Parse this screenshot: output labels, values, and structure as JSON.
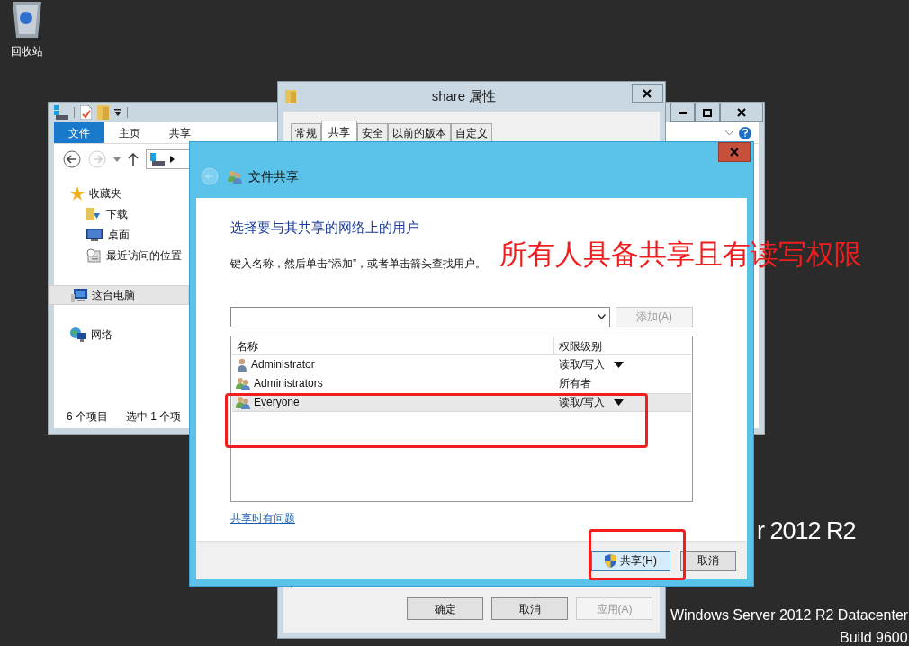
{
  "desktop": {
    "icons": [
      {
        "label": "回收站"
      }
    ],
    "branding": {
      "product": "r 2012 R2",
      "edition": "Windows Server 2012 R2 Datacenter",
      "build": "Build 9600"
    }
  },
  "explorer": {
    "ribbon_tabs": [
      {
        "label": "文件",
        "selected": true
      },
      {
        "label": "主页",
        "selected": false
      },
      {
        "label": "共享",
        "selected": false
      }
    ],
    "nav_pane": [
      {
        "label": "收藏夹",
        "selected": false,
        "children": [
          {
            "label": "下载",
            "selected": false
          },
          {
            "label": "桌面",
            "selected": false
          },
          {
            "label": "最近访问的位置",
            "selected": false
          }
        ]
      },
      {
        "label": "这台电脑",
        "selected": true
      },
      {
        "label": "网络",
        "selected": false
      }
    ],
    "status_bar": [
      "6 个项目",
      "选中 1 个项"
    ]
  },
  "properties": {
    "title": "share 属性",
    "tabs": [
      {
        "label": "常规",
        "selected": false
      },
      {
        "label": "共享",
        "selected": true
      },
      {
        "label": "安全",
        "selected": false
      },
      {
        "label": "以前的版本",
        "selected": false
      },
      {
        "label": "自定义",
        "selected": false
      }
    ],
    "buttons": [
      {
        "label": "确定",
        "disabled": false
      },
      {
        "label": "取消",
        "disabled": false
      },
      {
        "label": "应用(A)",
        "disabled": true
      }
    ]
  },
  "dialog": {
    "title": "文件共享",
    "heading": "选择要与其共享的网络上的用户",
    "instruction": "键入名称，然后单击“添加”，或者单击箭头查找用户。",
    "add_button": {
      "label": "添加(A)",
      "disabled": true
    },
    "table": {
      "columns": [
        "名称",
        "权限级别"
      ],
      "rows": [
        {
          "name": "Administrator",
          "kind": "user",
          "permission": "读取/写入",
          "has_menu": true,
          "selected": false
        },
        {
          "name": "Administrators",
          "kind": "group",
          "permission": "所有者",
          "has_menu": false,
          "selected": false
        },
        {
          "name": "Everyone",
          "kind": "group",
          "permission": "读取/写入",
          "has_menu": true,
          "selected": true
        }
      ]
    },
    "help_link": "共享时有问题",
    "buttons": [
      {
        "label": "共享(H)",
        "kind": "elevated",
        "focused": true
      },
      {
        "label": "取消",
        "kind": "plain",
        "focused": false
      }
    ]
  },
  "annotation": {
    "note": "所有人具备共享且有读写权限"
  }
}
